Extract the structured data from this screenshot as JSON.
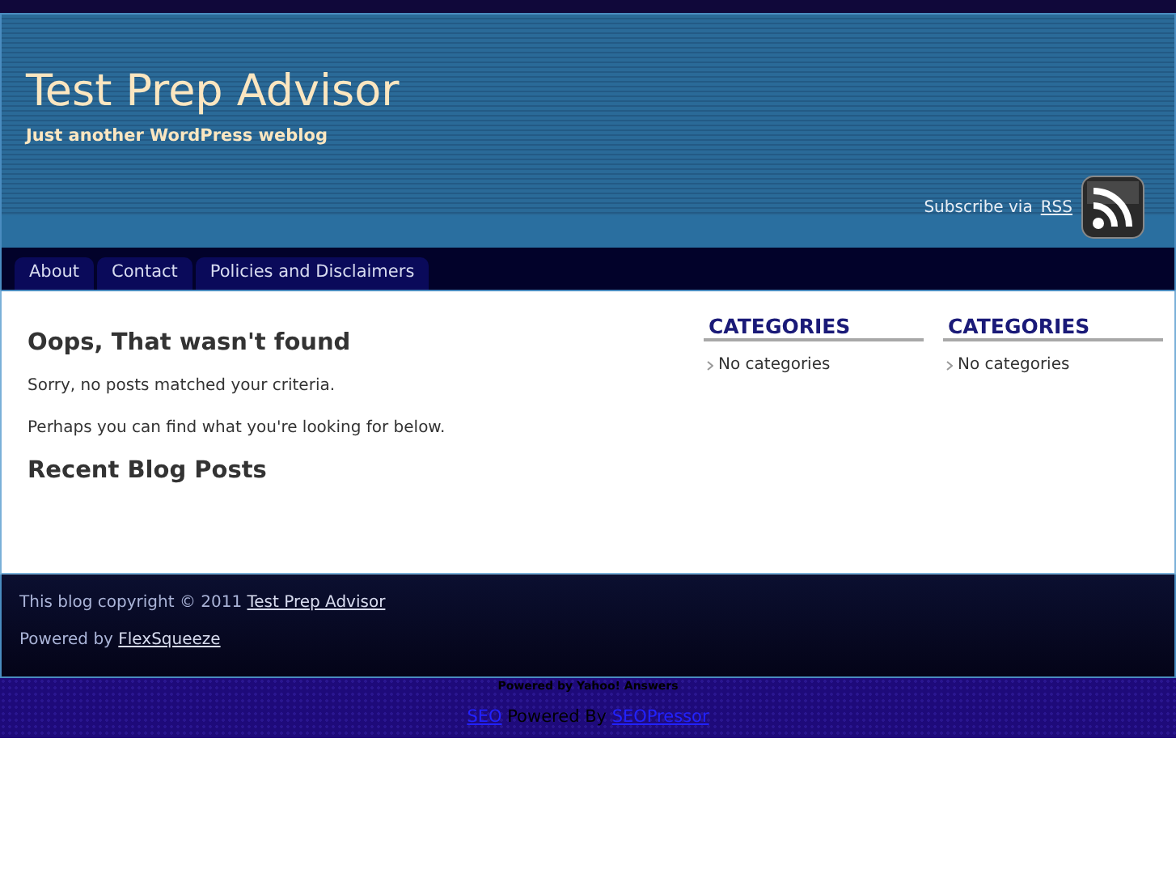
{
  "header": {
    "title": "Test Prep Advisor",
    "tagline": "Just another WordPress weblog",
    "subscribe": {
      "text": "Subscribe via",
      "link": "RSS"
    }
  },
  "nav": [
    {
      "label": "About"
    },
    {
      "label": "Contact"
    },
    {
      "label": "Policies and Disclaimers"
    }
  ],
  "main": {
    "heading": "Oops, That wasn't found",
    "paragraphs": [
      "Sorry, no posts matched your criteria.",
      "Perhaps you can find what you're looking for below."
    ],
    "recent_heading": "Recent Blog Posts"
  },
  "widgets": [
    {
      "title": "CATEGORIES",
      "items": [
        "No categories"
      ]
    },
    {
      "title": "CATEGORIES",
      "items": [
        "No categories"
      ]
    }
  ],
  "footer": {
    "copyright": {
      "text": "This blog copyright © 2011",
      "link": "Test Prep Advisor"
    },
    "powered": {
      "text": "Powered by",
      "link": "FlexSqueeze"
    }
  },
  "bottom": {
    "yahoo": "Powered by Yahoo! Answers",
    "seo_link": "SEO",
    "seo_text": "Powered By",
    "seo_brand": "SEOPressor"
  }
}
